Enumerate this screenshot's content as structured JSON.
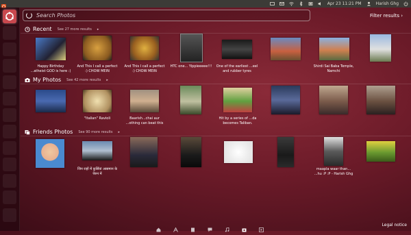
{
  "topbar": {
    "date_time": "Apr 23  11:21 PM",
    "user": "Harish Ghg"
  },
  "search": {
    "placeholder": "Search Photos",
    "filter_label": "Filter results"
  },
  "sections": [
    {
      "title": "Recent",
      "more": "See 27 more results",
      "items": [
        {
          "caption": "Happy Birthday ...atheist GOD is here :)"
        },
        {
          "caption": "And This I call a perfect :) CHOW MEIN"
        },
        {
          "caption": "And This I call a perfect :) CHOW MEIN"
        },
        {
          "caption": "HTC one... Yippieeeee!!!"
        },
        {
          "caption": "One of the earliest ...eel and rubber tyres"
        },
        {
          "caption": ""
        },
        {
          "caption": "Shirdi Sai Baba Temple, Namchi"
        },
        {
          "caption": ""
        }
      ]
    },
    {
      "title": "My Photos",
      "more": "See 42 more results",
      "items": [
        {
          "caption": ""
        },
        {
          "caption": "\"Italian\" Ravioli"
        },
        {
          "caption": "Baarish...chai aur ...othing can beat this"
        },
        {
          "caption": ""
        },
        {
          "caption": "Hit by a series of ...da becomes Taliban."
        },
        {
          "caption": ""
        },
        {
          "caption": ""
        },
        {
          "caption": ""
        }
      ]
    },
    {
      "title": "Friends Photos",
      "more": "See 90 more results",
      "items": [
        {
          "caption": ""
        },
        {
          "caption": "जिन राहों में कुर्सियां आसमान के पेरुन में"
        },
        {
          "caption": ""
        },
        {
          "caption": ""
        },
        {
          "caption": ""
        },
        {
          "caption": ""
        },
        {
          "caption": "maapla waar than... ...hu :P :P - Harish Ghg"
        },
        {
          "caption": ""
        }
      ]
    }
  ],
  "footer": {
    "legal": "Legal notice"
  },
  "colors": {
    "accent": "#c8484e",
    "panel": "#3c3b37"
  }
}
